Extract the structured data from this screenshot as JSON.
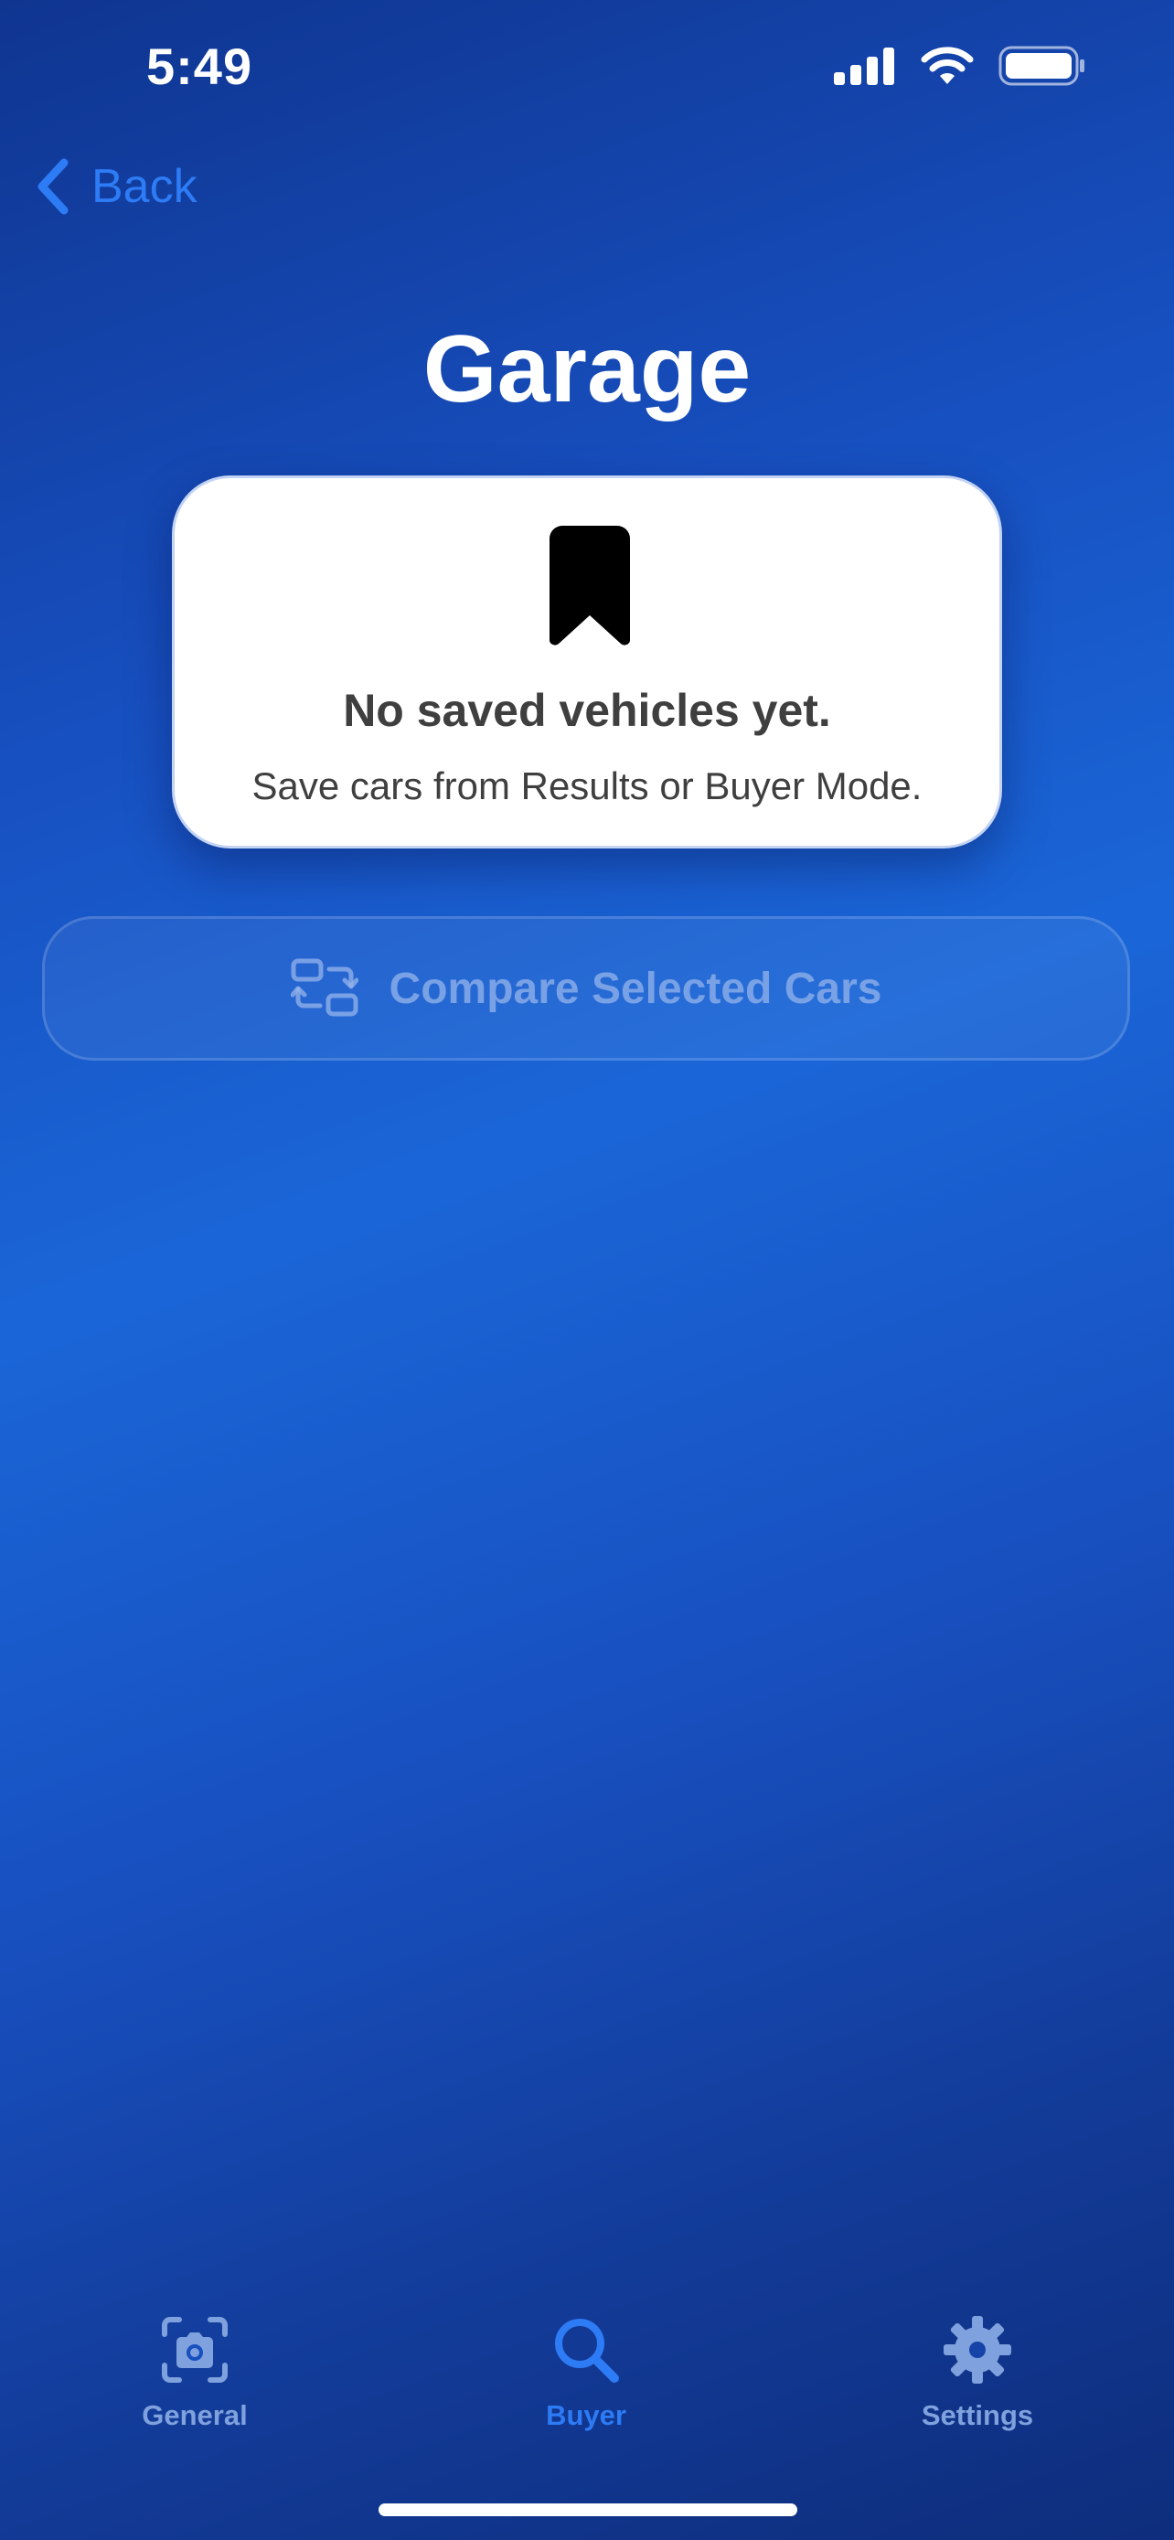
{
  "status_bar": {
    "time": "5:49",
    "icons": [
      "cellular-signal-icon",
      "wifi-icon",
      "battery-icon"
    ]
  },
  "nav": {
    "back_label": "Back",
    "back_icon": "chevron-left-icon"
  },
  "page": {
    "title": "Garage"
  },
  "empty_state": {
    "icon": "bookmark-icon",
    "title": "No saved vehicles yet.",
    "subtitle": "Save cars from Results or Buyer Mode."
  },
  "compare_button": {
    "icon": "compare-swap-icon",
    "label": "Compare Selected Cars",
    "enabled": false
  },
  "tab_bar": {
    "tabs": [
      {
        "label": "General",
        "icon": "camera-scan-icon",
        "selected": false
      },
      {
        "label": "Buyer",
        "icon": "magnifying-glass-icon",
        "selected": true
      },
      {
        "label": "Settings",
        "icon": "gear-icon",
        "selected": false
      }
    ]
  },
  "colors": {
    "accent": "#2D7BF5",
    "background_top": "#0F3590",
    "background_mid": "#1A66D8",
    "tab_inactive": "#7FA1DD",
    "card_text": "#3F3F3F"
  }
}
